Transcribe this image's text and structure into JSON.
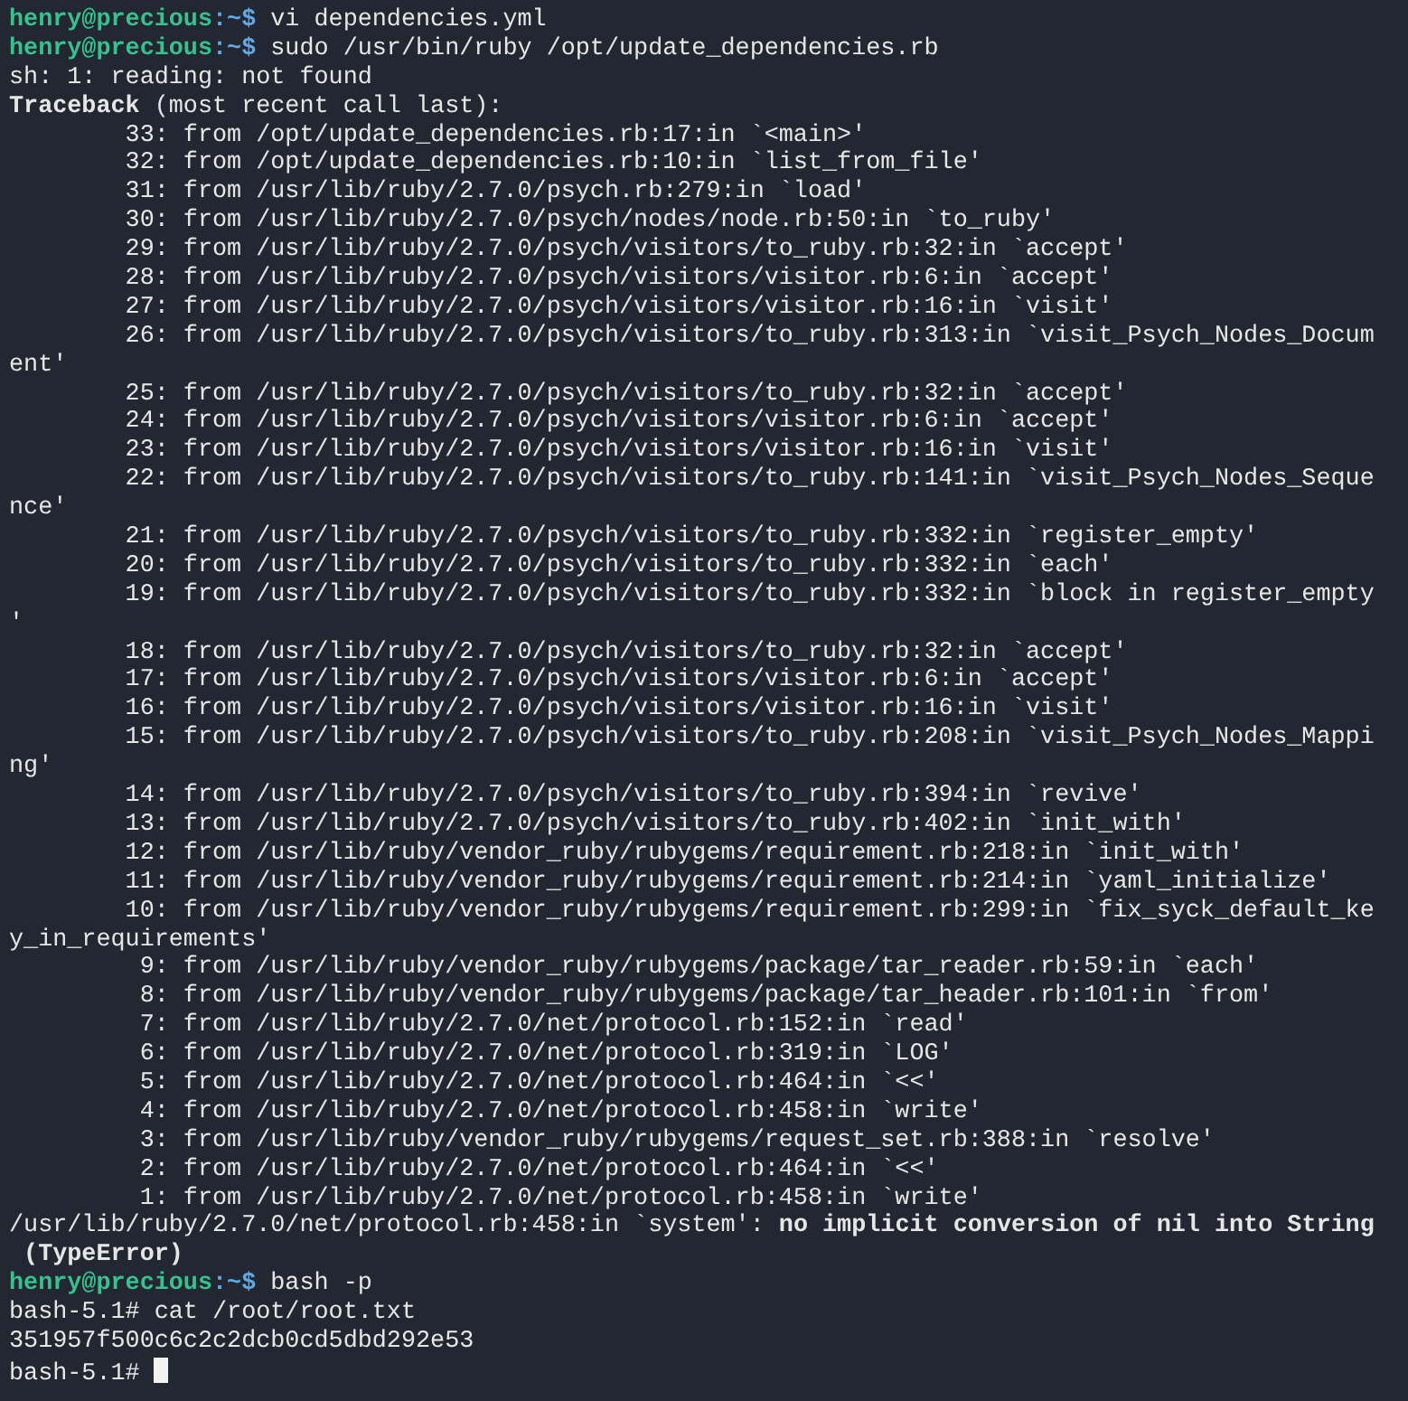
{
  "terminal": {
    "lines": [
      {
        "kind": "prompt",
        "user": "henry@precious",
        "path": ":~$",
        "command": "vi dependencies.yml"
      },
      {
        "kind": "prompt",
        "user": "henry@precious",
        "path": ":~$",
        "command": "sudo /usr/bin/ruby /opt/update_dependencies.rb"
      },
      {
        "kind": "output",
        "text": "sh: 1: reading: not found"
      },
      {
        "kind": "output",
        "text": "**Traceback** (most recent call last):"
      },
      {
        "kind": "output",
        "text": "        33: from /opt/update_dependencies.rb:17:in `<main>'"
      },
      {
        "kind": "output",
        "text": "        32: from /opt/update_dependencies.rb:10:in `list_from_file'"
      },
      {
        "kind": "output",
        "text": "        31: from /usr/lib/ruby/2.7.0/psych.rb:279:in `load'"
      },
      {
        "kind": "output",
        "text": "        30: from /usr/lib/ruby/2.7.0/psych/nodes/node.rb:50:in `to_ruby'"
      },
      {
        "kind": "output",
        "text": "        29: from /usr/lib/ruby/2.7.0/psych/visitors/to_ruby.rb:32:in `accept'"
      },
      {
        "kind": "output",
        "text": "        28: from /usr/lib/ruby/2.7.0/psych/visitors/visitor.rb:6:in `accept'"
      },
      {
        "kind": "output",
        "text": "        27: from /usr/lib/ruby/2.7.0/psych/visitors/visitor.rb:16:in `visit'"
      },
      {
        "kind": "output",
        "text": "        26: from /usr/lib/ruby/2.7.0/psych/visitors/to_ruby.rb:313:in `visit_Psych_Nodes_Docum"
      },
      {
        "kind": "output",
        "text": "ent'"
      },
      {
        "kind": "output",
        "text": "        25: from /usr/lib/ruby/2.7.0/psych/visitors/to_ruby.rb:32:in `accept'"
      },
      {
        "kind": "output",
        "text": "        24: from /usr/lib/ruby/2.7.0/psych/visitors/visitor.rb:6:in `accept'"
      },
      {
        "kind": "output",
        "text": "        23: from /usr/lib/ruby/2.7.0/psych/visitors/visitor.rb:16:in `visit'"
      },
      {
        "kind": "output",
        "text": "        22: from /usr/lib/ruby/2.7.0/psych/visitors/to_ruby.rb:141:in `visit_Psych_Nodes_Seque"
      },
      {
        "kind": "output",
        "text": "nce'"
      },
      {
        "kind": "output",
        "text": "        21: from /usr/lib/ruby/2.7.0/psych/visitors/to_ruby.rb:332:in `register_empty'"
      },
      {
        "kind": "output",
        "text": "        20: from /usr/lib/ruby/2.7.0/psych/visitors/to_ruby.rb:332:in `each'"
      },
      {
        "kind": "output",
        "text": "        19: from /usr/lib/ruby/2.7.0/psych/visitors/to_ruby.rb:332:in `block in register_empty"
      },
      {
        "kind": "output",
        "text": "'"
      },
      {
        "kind": "output",
        "text": "        18: from /usr/lib/ruby/2.7.0/psych/visitors/to_ruby.rb:32:in `accept'"
      },
      {
        "kind": "output",
        "text": "        17: from /usr/lib/ruby/2.7.0/psych/visitors/visitor.rb:6:in `accept'"
      },
      {
        "kind": "output",
        "text": "        16: from /usr/lib/ruby/2.7.0/psych/visitors/visitor.rb:16:in `visit'"
      },
      {
        "kind": "output",
        "text": "        15: from /usr/lib/ruby/2.7.0/psych/visitors/to_ruby.rb:208:in `visit_Psych_Nodes_Mappi"
      },
      {
        "kind": "output",
        "text": "ng'"
      },
      {
        "kind": "output",
        "text": "        14: from /usr/lib/ruby/2.7.0/psych/visitors/to_ruby.rb:394:in `revive'"
      },
      {
        "kind": "output",
        "text": "        13: from /usr/lib/ruby/2.7.0/psych/visitors/to_ruby.rb:402:in `init_with'"
      },
      {
        "kind": "output",
        "text": "        12: from /usr/lib/ruby/vendor_ruby/rubygems/requirement.rb:218:in `init_with'"
      },
      {
        "kind": "output",
        "text": "        11: from /usr/lib/ruby/vendor_ruby/rubygems/requirement.rb:214:in `yaml_initialize'"
      },
      {
        "kind": "output",
        "text": "        10: from /usr/lib/ruby/vendor_ruby/rubygems/requirement.rb:299:in `fix_syck_default_ke"
      },
      {
        "kind": "output",
        "text": "y_in_requirements'"
      },
      {
        "kind": "output",
        "text": "         9: from /usr/lib/ruby/vendor_ruby/rubygems/package/tar_reader.rb:59:in `each'"
      },
      {
        "kind": "output",
        "text": "         8: from /usr/lib/ruby/vendor_ruby/rubygems/package/tar_header.rb:101:in `from'"
      },
      {
        "kind": "output",
        "text": "         7: from /usr/lib/ruby/2.7.0/net/protocol.rb:152:in `read'"
      },
      {
        "kind": "output",
        "text": "         6: from /usr/lib/ruby/2.7.0/net/protocol.rb:319:in `LOG'"
      },
      {
        "kind": "output",
        "text": "         5: from /usr/lib/ruby/2.7.0/net/protocol.rb:464:in `<<'"
      },
      {
        "kind": "output",
        "text": "         4: from /usr/lib/ruby/2.7.0/net/protocol.rb:458:in `write'"
      },
      {
        "kind": "output",
        "text": "         3: from /usr/lib/ruby/vendor_ruby/rubygems/request_set.rb:388:in `resolve'"
      },
      {
        "kind": "output",
        "text": "         2: from /usr/lib/ruby/2.7.0/net/protocol.rb:464:in `<<'"
      },
      {
        "kind": "output",
        "text": "         1: from /usr/lib/ruby/2.7.0/net/protocol.rb:458:in `write'"
      },
      {
        "kind": "output",
        "text": "/usr/lib/ruby/2.7.0/net/protocol.rb:458:in `system': **no implicit conversion of nil into String**"
      },
      {
        "kind": "error_type",
        "text": " (**TypeError**)"
      },
      {
        "kind": "prompt",
        "user": "henry@precious",
        "path": ":~$",
        "command": "bash -p"
      },
      {
        "kind": "root_prompt",
        "prompt": "bash-5.1#",
        "command": "cat /root/root.txt"
      },
      {
        "kind": "output",
        "text": "351957f500c6c2c2dcb0cd5dbd292e53"
      },
      {
        "kind": "root_prompt",
        "prompt": "bash-5.1#",
        "cursor": true
      }
    ]
  }
}
